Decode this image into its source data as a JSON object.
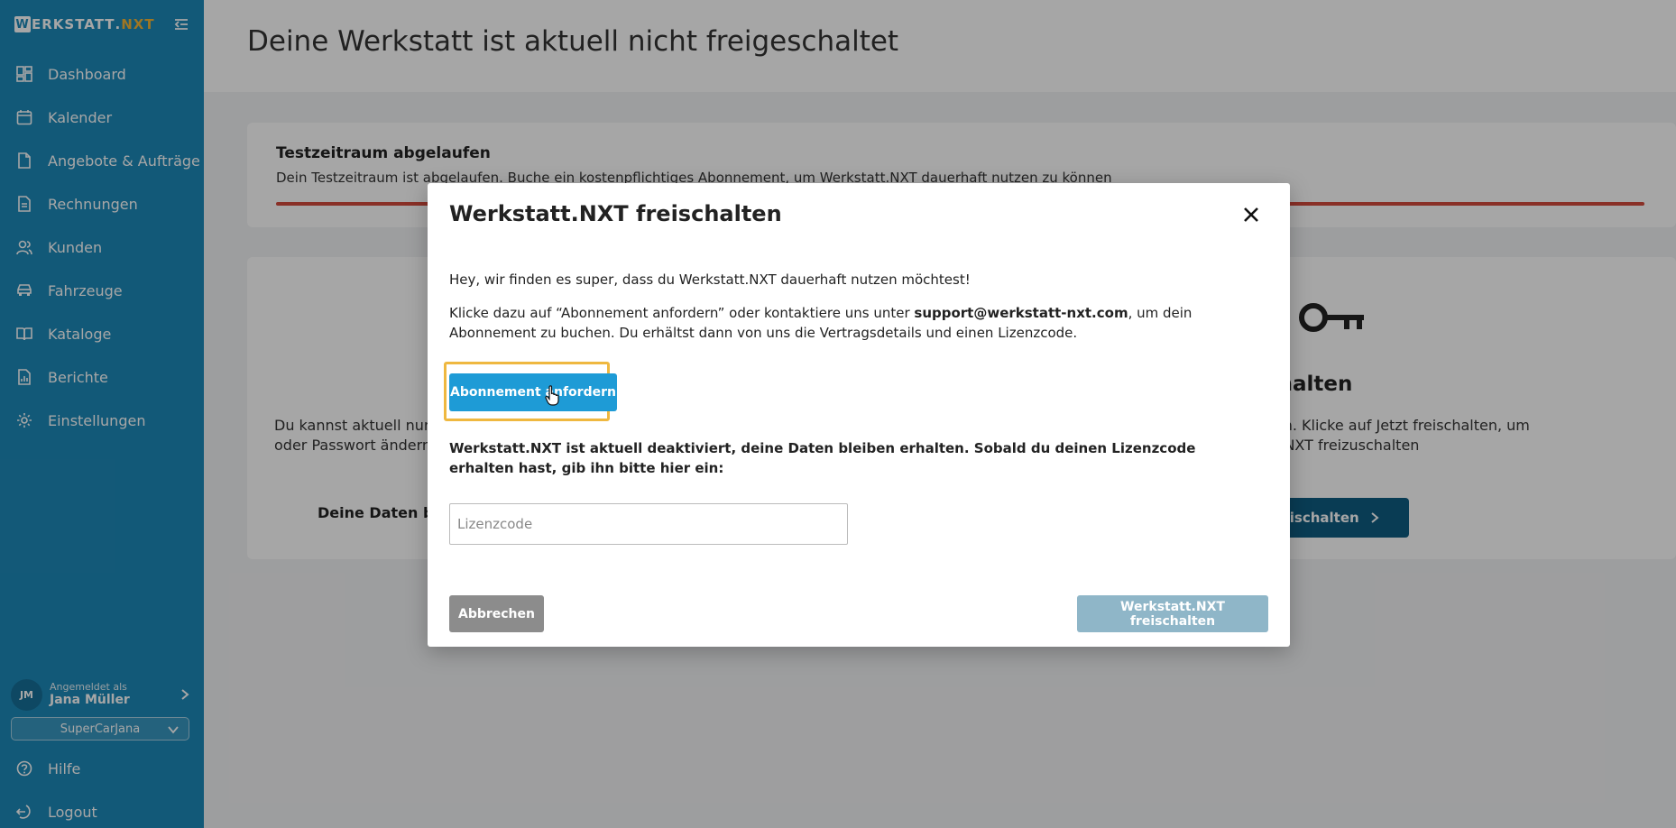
{
  "app": {
    "logo_first": "W",
    "logo_rest": "ERKSTATT",
    "logo_dot": ".",
    "logo_suffix": "NXT",
    "brand_color": "#1d89b9",
    "accent_color": "#f3b536"
  },
  "sidebar": {
    "items": [
      {
        "label": "Dashboard",
        "icon": "dashboard-icon"
      },
      {
        "label": "Kalender",
        "icon": "calendar-icon"
      },
      {
        "label": "Angebote & Aufträge",
        "icon": "document-icon"
      },
      {
        "label": "Rechnungen",
        "icon": "invoice-icon"
      },
      {
        "label": "Kunden",
        "icon": "users-icon"
      },
      {
        "label": "Fahrzeuge",
        "icon": "car-icon"
      },
      {
        "label": "Kataloge",
        "icon": "book-icon"
      },
      {
        "label": "Berichte",
        "icon": "report-icon"
      },
      {
        "label": "Einstellungen",
        "icon": "gear-icon"
      }
    ],
    "user": {
      "initials": "JM",
      "caption": "Angemeldet als",
      "name": "Jana Müller"
    },
    "shop": "SuperCarJana",
    "help_label": "Hilfe",
    "logout_label": "Logout"
  },
  "main": {
    "title": "Deine Werkstatt ist aktuell nicht freigeschaltet",
    "alert": {
      "title": "Testzeitraum abgelaufen",
      "text": "Dein Testzeitraum ist abgelaufen. Buche ein kostenpflichtiges Abonnement, um Werkstatt.NXT dauerhaft nutzen zu können"
    },
    "left_text": "Du kannst aktuell nur d                                                                                    oder Passwort ändern, ",
    "left_text_line1": "Du kannst aktuell nur d",
    "left_text_line2": "oder Passwort ändern,",
    "left_bold": "Deine Daten blei",
    "right_title": "t.NXT freischalten",
    "right_text_line1": "izenzcode freischalten. Klicke auf Jetzt freischalten, um",
    "right_text_line2": "orgen und Werkstatt.NXT freizuschalten",
    "right_button": "t freischalten"
  },
  "modal": {
    "title": "Werkstatt.NXT freischalten",
    "p1": "Hey, wir finden es super, dass du Werkstatt.NXT dauerhaft nutzen möchtest!",
    "p2_before": "Klicke dazu auf “Abonnement anfordern” oder kontaktiere uns unter ",
    "p2_email": "support@werkstatt-nxt.com",
    "p2_after": ", um dein Abonnement zu buchen. Du erhältst dann von uns die Vertragsdetails und einen Lizenzcode.",
    "request_button": "Abonnement anfordern",
    "p3": "Werkstatt.NXT ist aktuell deaktiviert, deine Daten bleiben erhalten. Sobald du deinen Lizenzcode erhalten hast, gib ihn bitte hier ein:",
    "license_placeholder": "Lizenzcode",
    "license_value": "",
    "cancel_button": "Abbrechen",
    "unlock_button": "Werkstatt.NXT freischalten"
  }
}
